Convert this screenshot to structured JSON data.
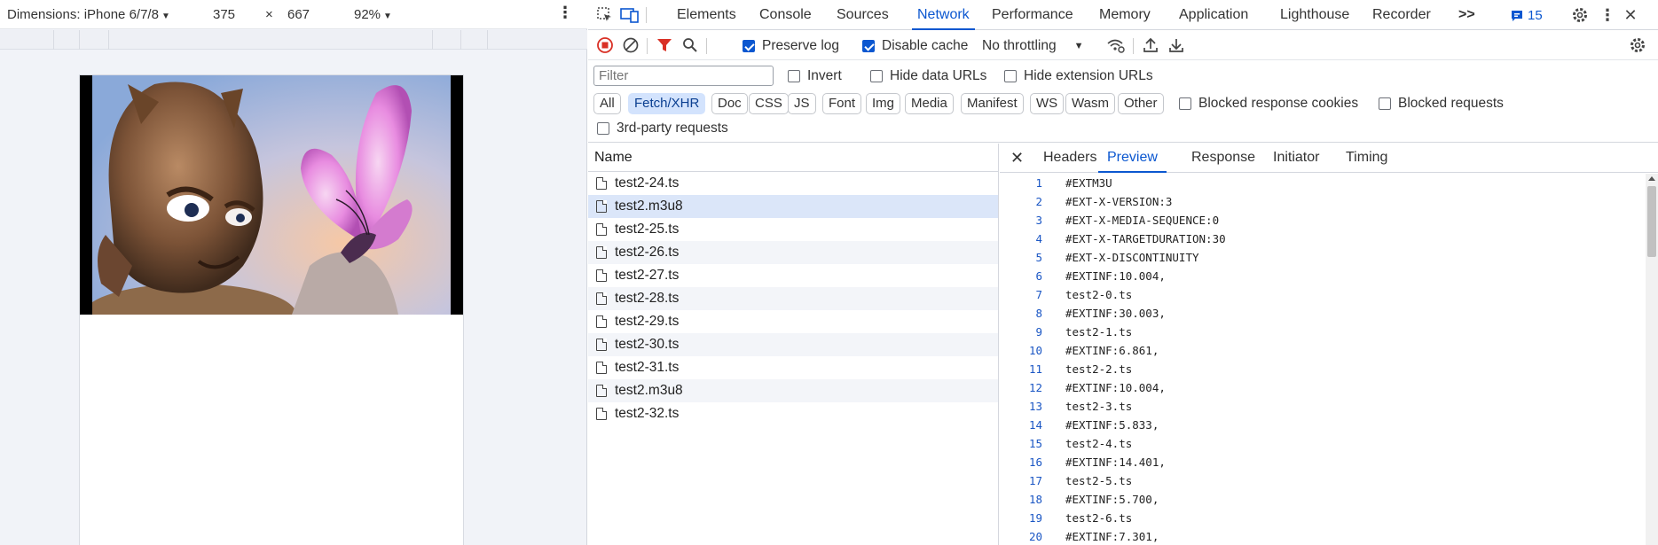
{
  "device_toolbar": {
    "dimensions_label": "Dimensions: iPhone 6/7/8",
    "width": "375",
    "times": "×",
    "height": "667",
    "zoom": "92%"
  },
  "main_tabs": [
    "Elements",
    "Console",
    "Sources",
    "Network",
    "Performance",
    "Memory",
    "Application",
    "Lighthouse",
    "Recorder"
  ],
  "active_tab": "Network",
  "overflow_label": ">>",
  "issues_count": "15",
  "net_toolbar": {
    "preserve_log": "Preserve log",
    "disable_cache": "Disable cache",
    "throttling": "No throttling"
  },
  "filter": {
    "placeholder": "Filter",
    "invert": "Invert",
    "hide_data_urls": "Hide data URLs",
    "hide_extension_urls": "Hide extension URLs",
    "types": [
      "All",
      "Fetch/XHR",
      "Doc",
      "CSS",
      "JS",
      "Font",
      "Img",
      "Media",
      "Manifest",
      "WS",
      "Wasm",
      "Other"
    ],
    "active_type": "Fetch/XHR",
    "blocked_response_cookies": "Blocked response cookies",
    "blocked_requests": "Blocked requests",
    "third_party": "3rd-party requests"
  },
  "request_list": {
    "header": "Name",
    "rows": [
      "test2-24.ts",
      "test2.m3u8",
      "test2-25.ts",
      "test2-26.ts",
      "test2-27.ts",
      "test2-28.ts",
      "test2-29.ts",
      "test2-30.ts",
      "test2-31.ts",
      "test2.m3u8",
      "test2-32.ts"
    ],
    "selected_index": 1
  },
  "preview": {
    "tabs": [
      "Headers",
      "Preview",
      "Response",
      "Initiator",
      "Timing"
    ],
    "active_tab": "Preview",
    "lines": [
      "#EXTM3U",
      "#EXT-X-VERSION:3",
      "#EXT-X-MEDIA-SEQUENCE:0",
      "#EXT-X-TARGETDURATION:30",
      "#EXT-X-DISCONTINUITY",
      "#EXTINF:10.004,",
      "test2-0.ts",
      "#EXTINF:30.003,",
      "test2-1.ts",
      "#EXTINF:6.861,",
      "test2-2.ts",
      "#EXTINF:10.004,",
      "test2-3.ts",
      "#EXTINF:5.833,",
      "test2-4.ts",
      "#EXTINF:14.401,",
      "test2-5.ts",
      "#EXTINF:5.700,",
      "test2-6.ts",
      "#EXTINF:7.301,"
    ]
  },
  "colors": {
    "accent": "#0b57d0",
    "record_red": "#d93025",
    "filter_red": "#d93025"
  }
}
